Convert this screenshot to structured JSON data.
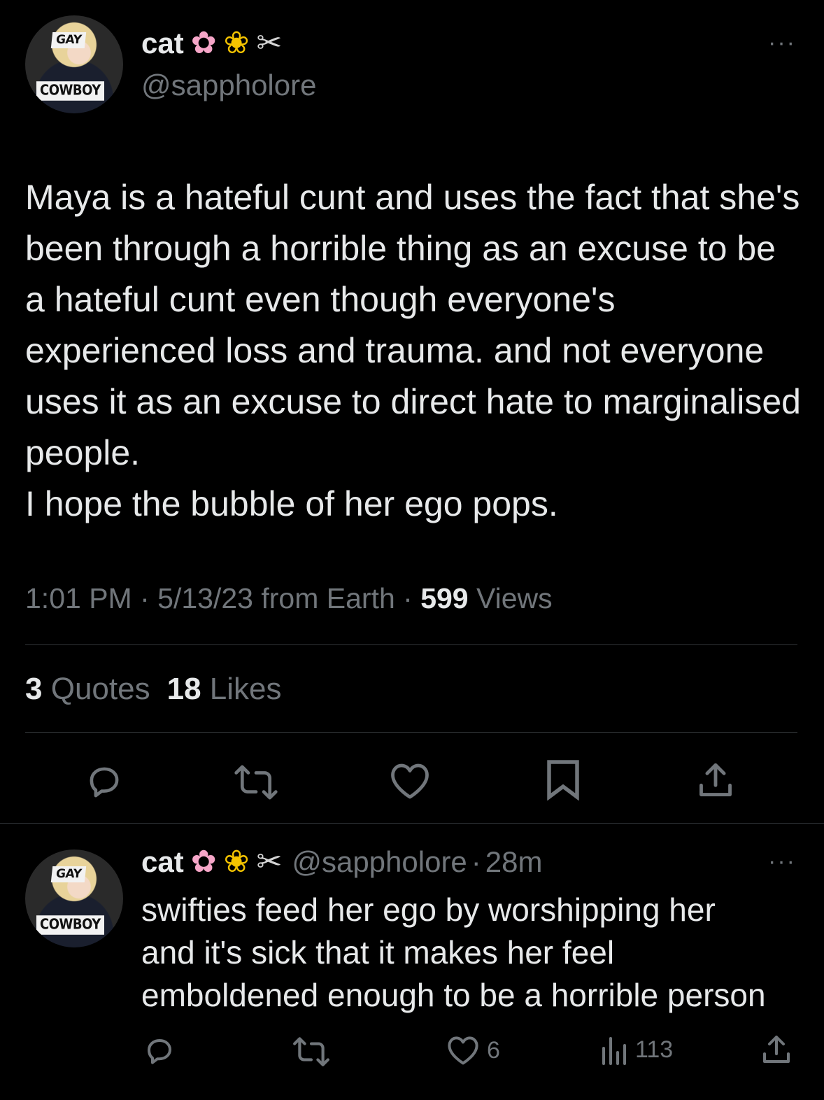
{
  "main_tweet": {
    "avatar": {
      "label_top": "GAY",
      "label_bottom": "COWBOY"
    },
    "display_name": "cat",
    "name_emojis": [
      "cherry-blossom",
      "blossom",
      "scissors"
    ],
    "handle": "@sappholore",
    "text": "Maya is a hateful cunt and uses the fact that she's been through a horrible thing as an excuse to be a hateful cunt even though everyone's experienced loss and trauma. and not everyone uses it as an excuse to direct hate to marginalised people.\nI hope the bubble of her ego pops.",
    "time": "1:01 PM",
    "date": "5/13/23",
    "source": "from Earth",
    "views_count": "599",
    "views_label": "Views",
    "quotes_count": "3",
    "quotes_label": "Quotes",
    "likes_count": "18",
    "likes_label": "Likes",
    "more_label": "···",
    "actions": [
      "reply-icon",
      "retweet-icon",
      "like-icon",
      "bookmark-icon",
      "share-icon"
    ]
  },
  "reply_tweet": {
    "avatar": {
      "label_top": "GAY",
      "label_bottom": "COWBOY"
    },
    "display_name": "cat",
    "handle": "@sappholore",
    "time_ago": "28m",
    "text": "swifties feed her ego by worshipping her\nand it's sick that it makes her feel\nemboldened enough to be a horrible person",
    "like_count": "6",
    "view_count": "113",
    "more_label": "···",
    "actions": [
      "reply-icon",
      "retweet-icon",
      "like-icon",
      "views-icon",
      "share-icon"
    ]
  },
  "colors": {
    "background": "#000000",
    "text": "#e7e9ea",
    "muted": "#71767b",
    "divider": "#2f3336"
  }
}
